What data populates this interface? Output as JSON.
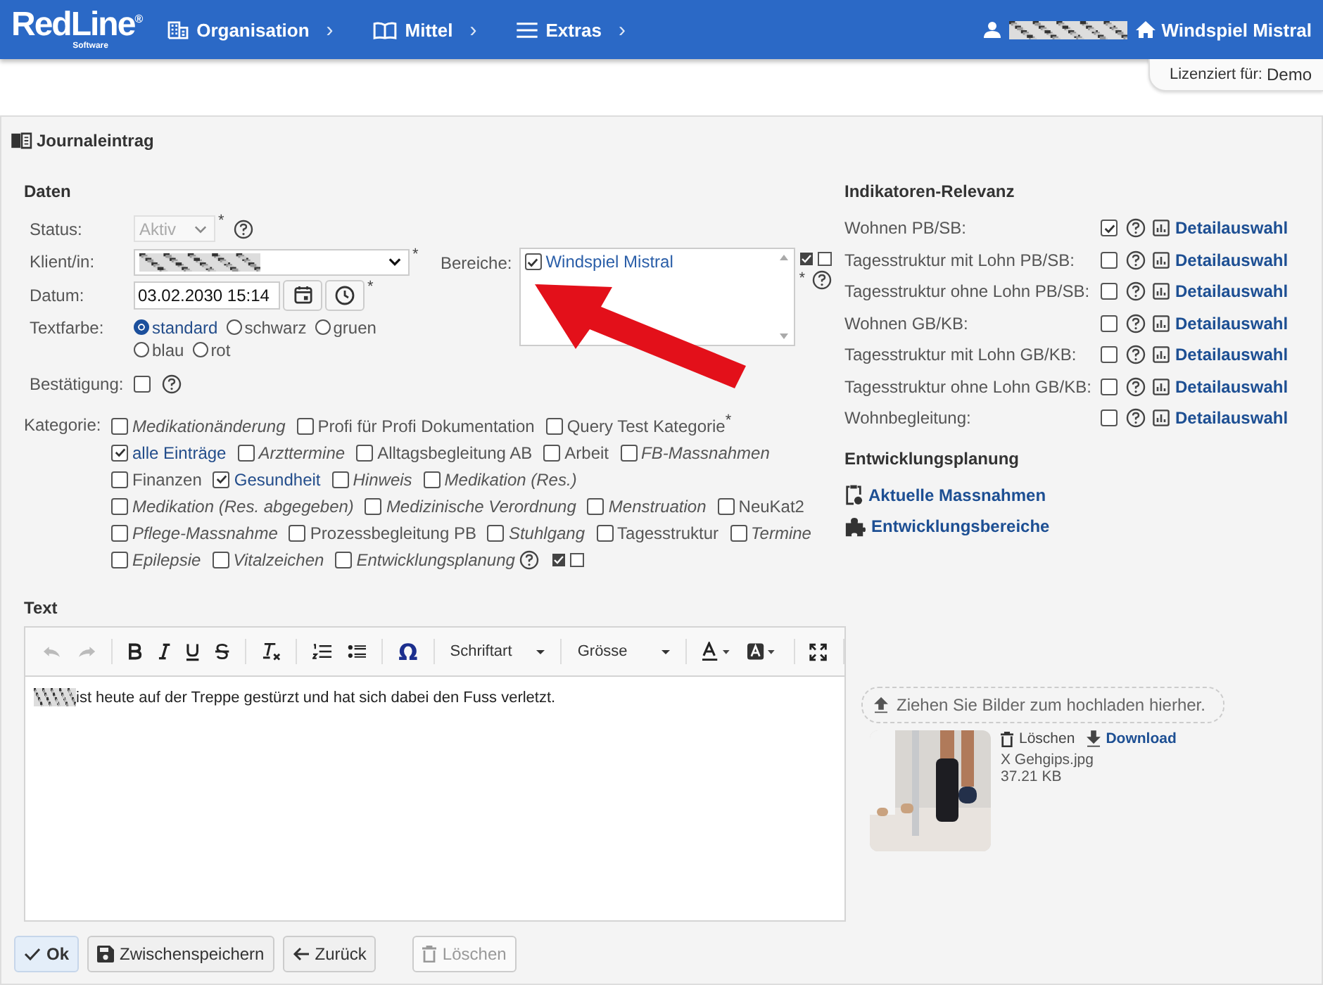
{
  "header": {
    "logo": {
      "name": "RedLine",
      "registered": "®",
      "sub": "Software"
    },
    "nav": [
      {
        "label": "Organisation",
        "caret": "›"
      },
      {
        "label": "Mittel",
        "caret": "›"
      },
      {
        "label": "Extras",
        "caret": "›"
      }
    ],
    "home": {
      "label": "Windspiel Mistral"
    },
    "license": {
      "label": "Lizenziert für:",
      "value": "Demo"
    }
  },
  "panel": {
    "title": "Journaleintrag"
  },
  "daten": {
    "heading": "Daten",
    "status": {
      "label": "Status:",
      "value": "Aktiv",
      "disabled": true,
      "required_mark": "*"
    },
    "klient": {
      "label": "Klient/in:",
      "required_mark": "*"
    },
    "datum": {
      "label": "Datum:",
      "value": "03.02.2030 15:14",
      "required_mark": "*"
    },
    "textfarbe": {
      "label": "Textfarbe:",
      "options": [
        {
          "label": "standard",
          "selected": true
        },
        {
          "label": "schwarz",
          "selected": false
        },
        {
          "label": "gruen",
          "selected": false
        },
        {
          "label": "blau",
          "selected": false
        },
        {
          "label": "rot",
          "selected": false
        }
      ]
    },
    "bestaetigung": {
      "label": "Bestätigung:",
      "checked": false
    },
    "bereiche": {
      "label": "Bereiche:",
      "required_mark": "*",
      "items": [
        {
          "label": "Windspiel Mistral",
          "checked": true
        }
      ]
    }
  },
  "kategorie": {
    "label": "Kategorie:",
    "items": [
      {
        "label": "Medikationänderung",
        "checked": false,
        "inactive": true,
        "help": false
      },
      {
        "label": "Profi für Profi Dokumentation",
        "checked": false,
        "inactive": false,
        "help": false
      },
      {
        "label": "Query Test Kategorie",
        "checked": false,
        "inactive": false,
        "help": false,
        "suffix": "*"
      },
      {
        "label": "alle Einträge",
        "checked": true,
        "inactive": false,
        "help": false
      },
      {
        "label": "Arzttermine",
        "checked": false,
        "inactive": true,
        "help": false
      },
      {
        "label": "Alltagsbegleitung AB",
        "checked": false,
        "inactive": false,
        "help": false
      },
      {
        "label": "Arbeit",
        "checked": false,
        "inactive": false,
        "help": false
      },
      {
        "label": "FB-Massnahmen",
        "checked": false,
        "inactive": true,
        "help": false
      },
      {
        "label": "Finanzen",
        "checked": false,
        "inactive": false,
        "help": false
      },
      {
        "label": "Gesundheit",
        "checked": true,
        "inactive": false,
        "help": false
      },
      {
        "label": "Hinweis",
        "checked": false,
        "inactive": true,
        "help": false
      },
      {
        "label": "Medikation (Res.)",
        "checked": false,
        "inactive": true,
        "help": false
      },
      {
        "label": "Medikation (Res. abgegeben)",
        "checked": false,
        "inactive": true,
        "help": false
      },
      {
        "label": "Medizinische Verordnung",
        "checked": false,
        "inactive": true,
        "help": false
      },
      {
        "label": "Menstruation",
        "checked": false,
        "inactive": true,
        "help": false
      },
      {
        "label": "NeuKat2",
        "checked": false,
        "inactive": false,
        "help": false
      },
      {
        "label": "Pflege-Massnahme",
        "checked": false,
        "inactive": true,
        "help": false
      },
      {
        "label": "Prozessbegleitung PB",
        "checked": false,
        "inactive": false,
        "help": false
      },
      {
        "label": "Stuhlgang",
        "checked": false,
        "inactive": true,
        "help": false
      },
      {
        "label": "Tagesstruktur",
        "checked": false,
        "inactive": false,
        "help": false
      },
      {
        "label": "Termine",
        "checked": false,
        "inactive": true,
        "help": false
      },
      {
        "label": "Epilepsie",
        "checked": false,
        "inactive": true,
        "help": false
      },
      {
        "label": "Vitalzeichen",
        "checked": false,
        "inactive": true,
        "help": false
      },
      {
        "label": "Entwicklungsplanung",
        "checked": false,
        "inactive": true,
        "help": true
      }
    ]
  },
  "indikatoren": {
    "heading": "Indikatoren-Relevanz",
    "rows": [
      {
        "label": "Wohnen PB/SB:",
        "checked": true,
        "link": "Detailauswahl"
      },
      {
        "label": "Tagesstruktur mit Lohn PB/SB:",
        "checked": false,
        "link": "Detailauswahl"
      },
      {
        "label": "Tagesstruktur ohne Lohn PB/SB:",
        "checked": false,
        "link": "Detailauswahl"
      },
      {
        "label": "Wohnen GB/KB:",
        "checked": false,
        "link": "Detailauswahl"
      },
      {
        "label": "Tagesstruktur mit Lohn GB/KB:",
        "checked": false,
        "link": "Detailauswahl"
      },
      {
        "label": "Tagesstruktur ohne Lohn GB/KB:",
        "checked": false,
        "link": "Detailauswahl"
      },
      {
        "label": "Wohnbegleitung:",
        "checked": false,
        "link": "Detailauswahl"
      }
    ]
  },
  "entwicklung": {
    "heading": "Entwicklungsplanung",
    "links": [
      {
        "label": "Aktuelle Massnahmen"
      },
      {
        "label": "Entwicklungsbereiche"
      }
    ]
  },
  "text": {
    "heading": "Text",
    "special_char": "Ω",
    "font": "Schriftart",
    "size": "Grösse",
    "body": "ist heute auf der Treppe gestürzt und hat sich dabei den Fuss verletzt."
  },
  "upload": {
    "drop_hint": "Ziehen Sie Bilder zum hochladen hierher.",
    "file": {
      "kind": "picture",
      "delete": "Löschen",
      "download": "Download",
      "name": "X Gehgips.jpg",
      "size": "37.21 KB"
    }
  },
  "buttons": [
    {
      "label": "Ok",
      "primary": true,
      "disabled": false
    },
    {
      "label": "Zwischenspeichern",
      "primary": false,
      "disabled": false
    },
    {
      "label": "Zurück",
      "primary": false,
      "disabled": false
    },
    {
      "label": "Löschen",
      "primary": false,
      "disabled": true
    }
  ]
}
